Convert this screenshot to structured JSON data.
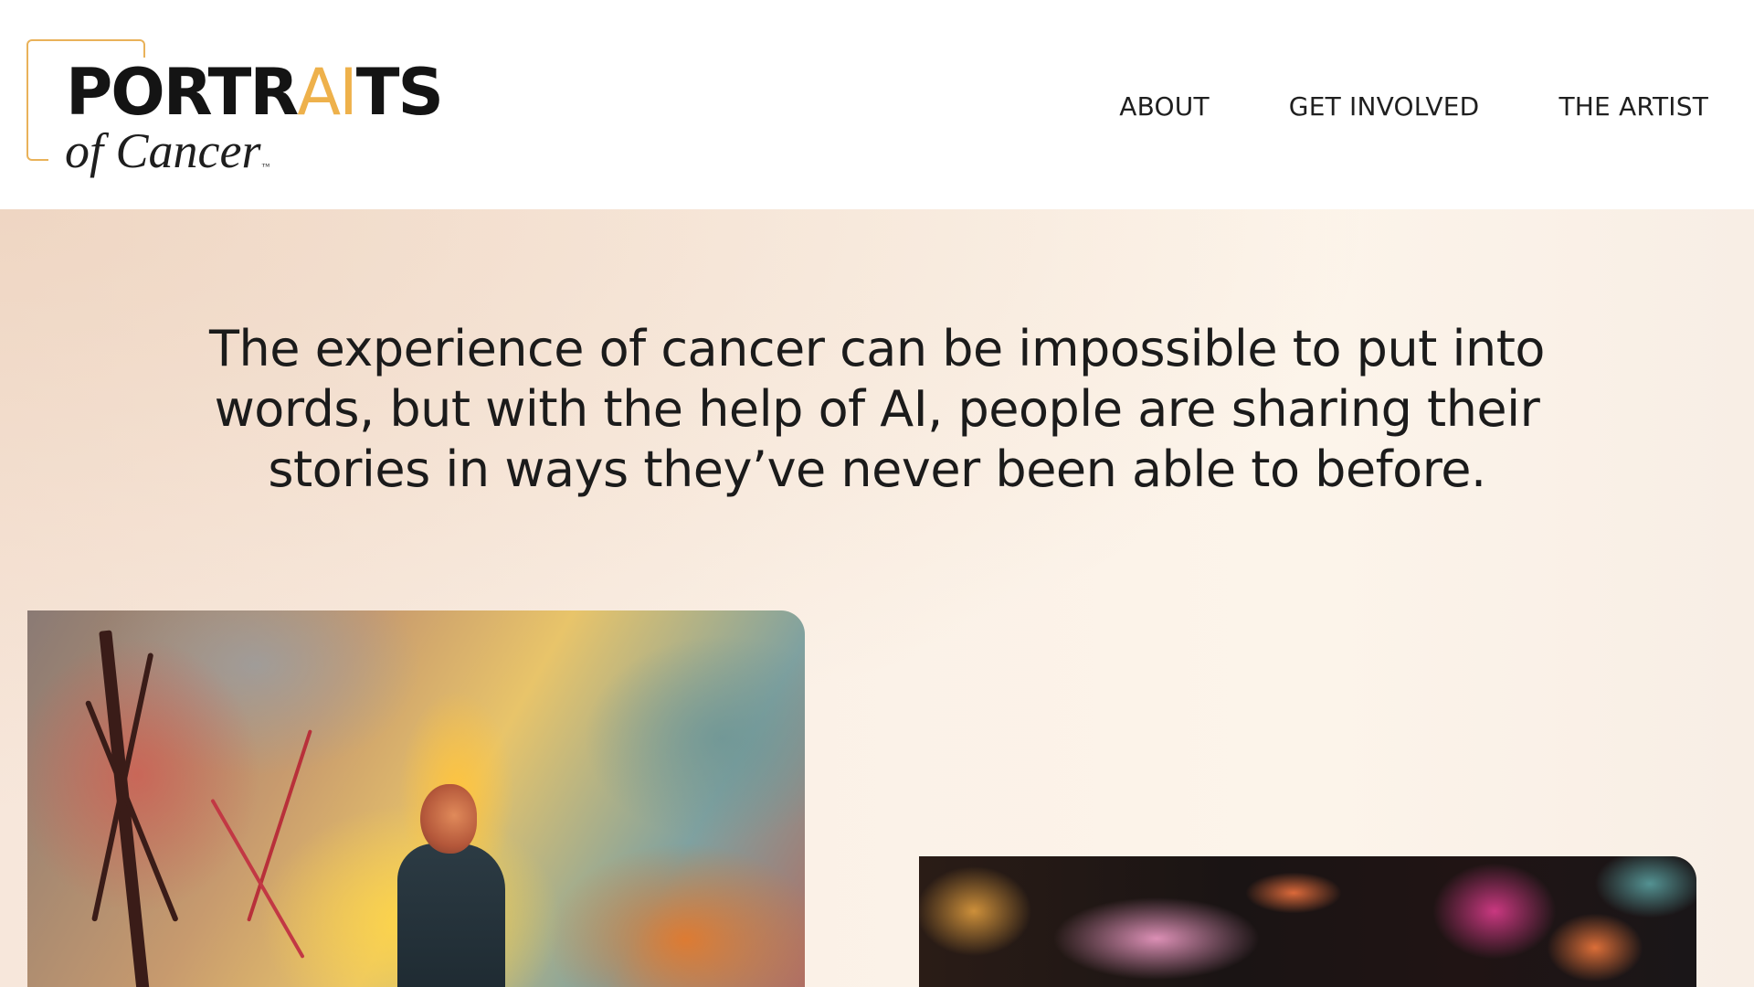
{
  "brand": {
    "title_prefix": "PORTR",
    "title_accent": "AI",
    "title_suffix": "TS",
    "subtitle": "of Cancer",
    "trademark": "™"
  },
  "nav": {
    "items": [
      {
        "label": "ABOUT"
      },
      {
        "label": "GET INVOLVED"
      },
      {
        "label": "THE ARTIST"
      }
    ]
  },
  "hero": {
    "text": "The experience of cancer can be impossible to put into words, but with the help of AI, people are sharing their stories in ways they’ve never been able to before."
  },
  "colors": {
    "accent": "#eeb14b",
    "text": "#1b1b1b",
    "hero_background": "#fbf1e7"
  }
}
